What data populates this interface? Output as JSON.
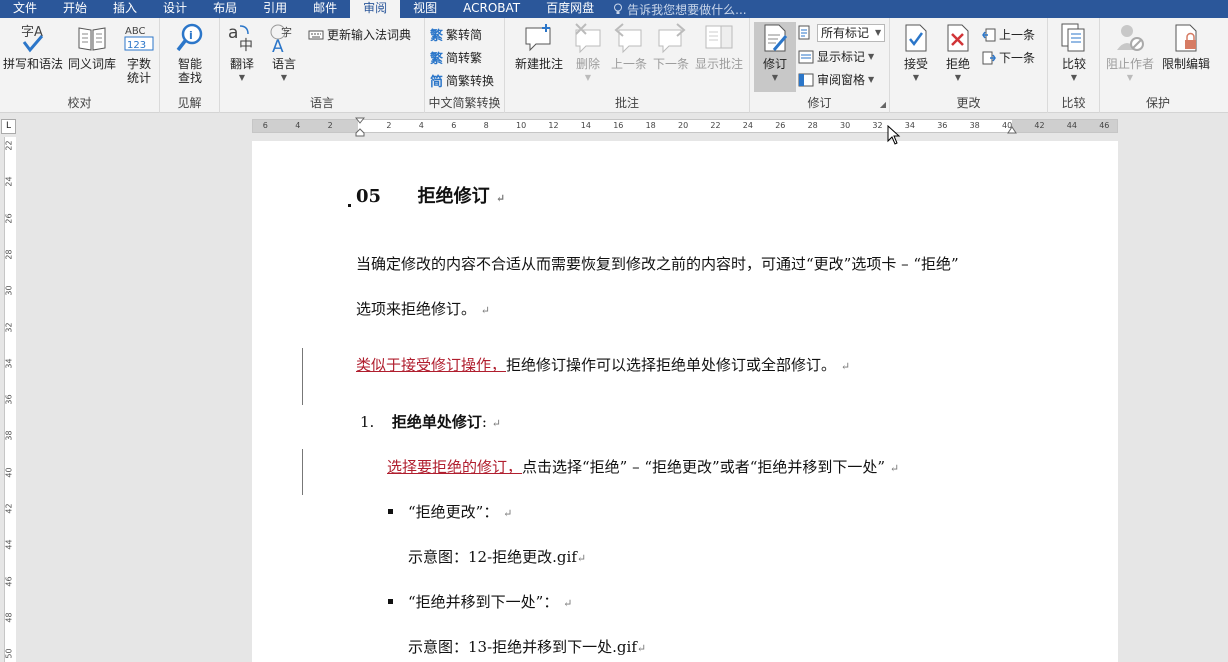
{
  "tabs": [
    "文件",
    "开始",
    "插入",
    "设计",
    "布局",
    "引用",
    "邮件",
    "审阅",
    "视图",
    "ACROBAT",
    "百度网盘"
  ],
  "active_tab": "审阅",
  "tell_me": "告诉我您想要做什么...",
  "groups": {
    "proofing": {
      "label": "校对",
      "spelling": "拼写和语法",
      "thesaurus": "同义词库",
      "wordcount_1": "字数",
      "wordcount_2": "统计"
    },
    "insights": {
      "label": "见解",
      "smart_1": "智能",
      "smart_2": "查找"
    },
    "language": {
      "label": "语言",
      "translate": "翻译",
      "language": "语言",
      "update_ime": "更新输入法词典"
    },
    "chinese": {
      "label": "中文简繁转换",
      "to_simplified": "繁转简",
      "to_traditional": "简转繁",
      "convert": "简繁转换"
    },
    "comments": {
      "label": "批注",
      "new": "新建批注",
      "delete": "删除",
      "prev": "上一条",
      "next": "下一条",
      "show": "显示批注"
    },
    "tracking": {
      "label": "修订",
      "track": "修订",
      "all_markup": "所有标记",
      "show_markup": "显示标记",
      "review_pane": "审阅窗格"
    },
    "changes": {
      "label": "更改",
      "accept": "接受",
      "reject": "拒绝",
      "prev": "上一条",
      "next": "下一条"
    },
    "compare": {
      "label": "比较",
      "compare": "比较"
    },
    "protect": {
      "label": "保护",
      "block_authors": "阻止作者",
      "restrict": "限制编辑"
    }
  },
  "ruler": {
    "h_left": [
      "6",
      "4",
      "2"
    ],
    "h_right": [
      "2",
      "4",
      "6",
      "8",
      "10",
      "12",
      "14",
      "16",
      "18",
      "20",
      "22",
      "24",
      "26",
      "28",
      "30",
      "32",
      "34",
      "36",
      "38",
      "40",
      "42",
      "44",
      "46"
    ],
    "v": [
      "22",
      "24",
      "26",
      "28",
      "30",
      "32",
      "34",
      "36",
      "38",
      "40",
      "42",
      "44",
      "46",
      "48",
      "50"
    ]
  },
  "document": {
    "heading_num": "05",
    "heading_text": "拒绝修订",
    "para1_line1": "当确定修改的内容不合适从而需要恢复到修改之前的内容时，可通过“更改”选项卡 – “拒绝”",
    "para1_line2": "选项来拒绝修订。",
    "para2_rev": "类似于接受修订操作，",
    "para2_rest": "拒绝修订操作可以选择拒绝单处修订或全部修订。",
    "item1_num": "1.",
    "item1_title": "拒绝单处修订",
    "item1_colon": ":",
    "item1_rev": "选择要拒绝的修订，",
    "item1_rest": "点击选择“拒绝” – “拒绝更改”或者“拒绝并移到下一处”",
    "bullet1": "“拒绝更改”：",
    "bullet1_img": "示意图：12-拒绝更改.gif",
    "bullet2": "“拒绝并移到下一处”：",
    "bullet2_img": "示意图：13-拒绝并移到下一处.gif",
    "para_mark": "↵"
  }
}
